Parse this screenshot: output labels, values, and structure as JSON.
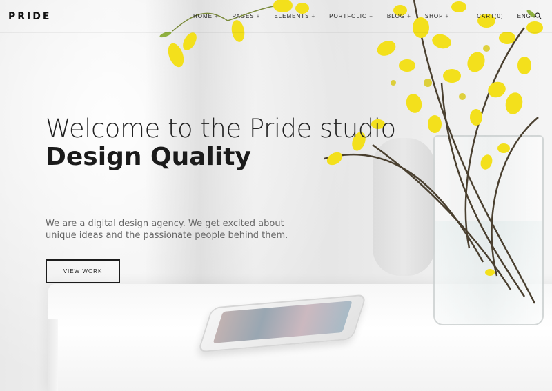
{
  "brand": {
    "logo": "PRIDE"
  },
  "nav": {
    "items": [
      {
        "label": "HOME",
        "suffix": "+"
      },
      {
        "label": "PAGES",
        "suffix": "+"
      },
      {
        "label": "ELEMENTS",
        "suffix": "+"
      },
      {
        "label": "PORTFOLIO",
        "suffix": "+"
      },
      {
        "label": "BLOG",
        "suffix": "+"
      },
      {
        "label": "SHOP",
        "suffix": "+"
      }
    ],
    "cart_label": "CART(0)",
    "lang_label": "ENG",
    "lang_suffix": "+",
    "search_icon": "search-icon"
  },
  "hero": {
    "title": "Welcome to the Pride studio",
    "subtitle": "Design Quality",
    "description": "We are a digital design agency. We get excited about unique ideas and the passionate people behind them.",
    "cta_label": "VIEW WORK"
  },
  "colors": {
    "text_dark": "#1b1b1b",
    "text_muted": "#666666",
    "flower_yellow": "#f2df1e",
    "background": "#ececec"
  }
}
